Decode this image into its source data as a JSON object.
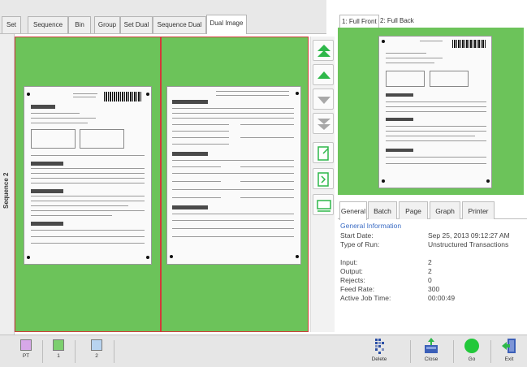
{
  "top_tabs": [
    "Set",
    "Sequence",
    "Bin",
    "Group",
    "Set Dual",
    "Sequence Dual",
    "Dual Image"
  ],
  "active_top_tab": "Dual Image",
  "side_label": "Sequence 2",
  "preview_tabs": [
    "1: Full Front",
    "2: Full Back"
  ],
  "info_tabs": [
    "General",
    "Batch",
    "Page",
    "Graph",
    "Printer"
  ],
  "info": {
    "section_title": "General Information",
    "rows": [
      {
        "label": "Start Date:",
        "value": "Sep 25, 2013 09:12:27 AM"
      },
      {
        "label": "Type of Run:",
        "value": "Unstructured Transactions"
      },
      {
        "label": "Input:",
        "value": "2"
      },
      {
        "label": "Output:",
        "value": "2"
      },
      {
        "label": "Rejects:",
        "value": "0"
      },
      {
        "label": "Feed Rate:",
        "value": "300"
      },
      {
        "label": "Active Job Time:",
        "value": "00:00:49"
      }
    ]
  },
  "pockets": [
    {
      "label": "PT",
      "color": "#d7a8e8"
    },
    {
      "label": "1",
      "color": "#7ccf6e"
    },
    {
      "label": "2",
      "color": "#b8d4f0"
    }
  ],
  "actions": [
    "Delete",
    "Close",
    "Go",
    "Exit"
  ],
  "colors": {
    "accent_green": "#6cc35a",
    "selection_border": "#d23a3a",
    "arrow_green": "#2eb84a",
    "info_title": "#3b6cc4"
  },
  "icons": {
    "nav_first": "double-up-arrow-icon",
    "nav_prev": "up-arrow-icon",
    "nav_next": "down-arrow-icon",
    "nav_last": "double-down-arrow-icon",
    "rotate": "rotate-page-icon",
    "flip": "flip-page-icon",
    "fit": "fit-page-icon"
  }
}
